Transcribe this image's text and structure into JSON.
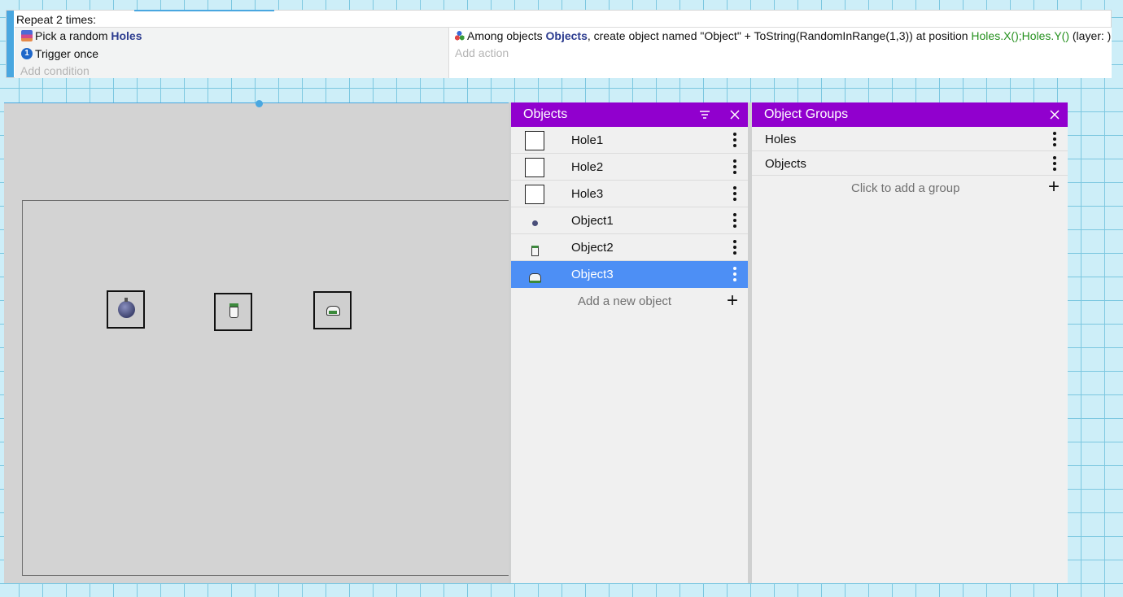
{
  "event": {
    "repeat_label": "Repeat 2 times:",
    "conditions": [
      {
        "icon": "pick-random-icon",
        "text": "Pick a random ",
        "object": "Holes"
      },
      {
        "icon": "trigger-once-icon",
        "text": "Trigger once"
      }
    ],
    "add_condition": "Add condition",
    "action": {
      "icon": "create-object-icon",
      "prefix": "Among objects ",
      "group": "Objects",
      "middle": ", create object named \"Object\" + ToString(RandomInRange(1,3)) at position ",
      "position": "Holes.X();Holes.Y()",
      "suffix": " (layer: )"
    },
    "add_action": "Add action"
  },
  "objects_panel": {
    "title": "Objects",
    "items": [
      {
        "name": "Hole1",
        "thumb": "empty-square"
      },
      {
        "name": "Hole2",
        "thumb": "empty-square"
      },
      {
        "name": "Hole3",
        "thumb": "empty-square"
      },
      {
        "name": "Object1",
        "thumb": "bomb-icon"
      },
      {
        "name": "Object2",
        "thumb": "pot-icon"
      },
      {
        "name": "Object3",
        "thumb": "car-icon",
        "selected": true
      }
    ],
    "add_label": "Add a new object"
  },
  "groups_panel": {
    "title": "Object Groups",
    "items": [
      "Holes",
      "Objects"
    ],
    "add_label": "Click to add a group"
  },
  "colors": {
    "panel_header": "#9100ce",
    "selection": "#4d8ff5",
    "accent": "#49a7e0"
  }
}
